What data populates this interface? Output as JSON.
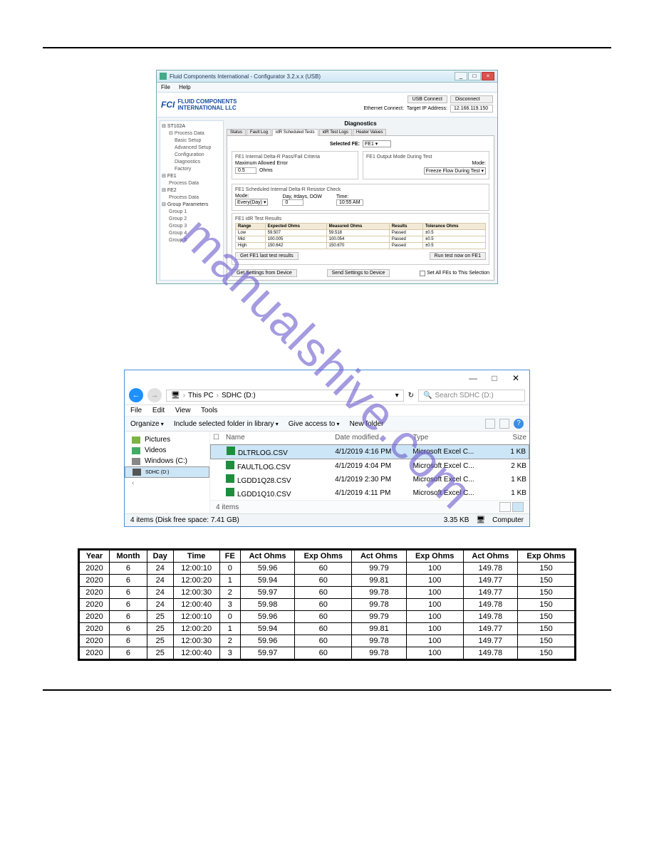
{
  "watermark": "manualshive.com",
  "app": {
    "title": "Fluid Components International - Configurator 3.2.x.x (USB)",
    "menu": {
      "file": "File",
      "help": "Help"
    },
    "logo_prefix": "FCI",
    "logo_line1": "FLUID COMPONENTS",
    "logo_line2": "INTERNATIONAL LLC",
    "conn": {
      "usb_btn": "USB Connect",
      "eth_label": "Ethernet Connect:",
      "ip_label": "Target IP Address:",
      "ip_value": "12.166.119.150",
      "disconnect": "Disconnect"
    },
    "tree": {
      "root": "ST102A",
      "n1": "Process Data",
      "n2": "Basic Setup",
      "n3": "Advanced Setup",
      "n4": "Configuration",
      "n5": "Diagnostics",
      "n6": "Factory",
      "fe1": "FE1",
      "fe1_pd": "Process Data",
      "fe2": "FE2",
      "fe2_pd": "Process Data",
      "grp": "Group Parameters",
      "g1": "Group 1",
      "g2": "Group 2",
      "g3": "Group 3",
      "g4": "Group 4",
      "g5": "Group 5"
    },
    "diag": {
      "title": "Diagnostics",
      "tabs": {
        "status": "Status",
        "fault": "Fault Log",
        "sched": "idR Scheduled Tests",
        "logs": "idR Test Logs",
        "heater": "Heater Values"
      },
      "selected_fe_label": "Selected FE:",
      "selected_fe_value": "FE1",
      "fs1_title": "FE1 Internal Delta-R Pass/Fail Criteria",
      "max_err_label": "Maximum Allowed Error",
      "max_err_value": "0.5",
      "ohms": "Ohms",
      "fs2_title": "FE1 Output Mode During Test",
      "mode_label": "Mode:",
      "mode_value": "Freeze Flow During Test",
      "fs3_title": "FE1 Scheduled Internal Delta-R Resistor Check",
      "mode2_value": "Every(Day)",
      "day_label": "Day, #days, DOW",
      "day_value": "0",
      "time_label": "Time:",
      "time_value": "10:55 AM",
      "fs4_title": "FE1 idR Test Results",
      "res_headers": [
        "Range",
        "Expected Ohms",
        "Measured Ohms",
        "Results",
        "Tolerance Ohms"
      ],
      "res_rows": [
        [
          "Low",
          "59.507",
          "59.518",
          "Passed",
          "±0.5"
        ],
        [
          "Mid",
          "100.005",
          "100.054",
          "Passed",
          "±0.5"
        ],
        [
          "High",
          "150.642",
          "150.670",
          "Passed",
          "±0.5"
        ]
      ],
      "get_results_btn": "Get FE1 last test results",
      "run_now_btn": "Run test now on FE1",
      "get_settings": "Get Settings from Device",
      "send_settings": "Send Settings to Device",
      "set_all_fe": "Set All FEs to This Selection"
    }
  },
  "explorer": {
    "path_pc": "This PC",
    "path_drive": "SDHC (D:)",
    "search_placeholder": "Search SDHC (D:)",
    "menu": {
      "file": "File",
      "edit": "Edit",
      "view": "View",
      "tools": "Tools"
    },
    "toolbar": {
      "organize": "Organize",
      "include": "Include selected folder in library",
      "give": "Give access to",
      "newf": "New folder"
    },
    "side": {
      "pictures": "Pictures",
      "videos": "Videos",
      "windows": "Windows (C:)",
      "sdhc": "SDHC (D:)"
    },
    "cols": {
      "name": "Name",
      "date": "Date modified",
      "type": "Type",
      "size": "Size"
    },
    "files": [
      {
        "name": "DLTRLOG.CSV",
        "date": "4/1/2019 4:16 PM",
        "type": "Microsoft Excel C...",
        "size": "1 KB",
        "sel": true
      },
      {
        "name": "FAULTLOG.CSV",
        "date": "4/1/2019 4:04 PM",
        "type": "Microsoft Excel C...",
        "size": "2 KB",
        "sel": false
      },
      {
        "name": "LGDD1Q28.CSV",
        "date": "4/1/2019 2:30 PM",
        "type": "Microsoft Excel C...",
        "size": "1 KB",
        "sel": false
      },
      {
        "name": "LGDD1Q10.CSV",
        "date": "4/1/2019 4:11 PM",
        "type": "Microsoft Excel C...",
        "size": "1 KB",
        "sel": false
      }
    ],
    "items_count": "4 items",
    "status": "4 items (Disk free space: 7.41 GB)",
    "status_size": "3.35 KB",
    "status_computer": "Computer"
  },
  "table": {
    "headers": [
      "Year",
      "Month",
      "Day",
      "Time",
      "FE",
      "Act Ohms",
      "Exp Ohms",
      "Act Ohms",
      "Exp Ohms",
      "Act Ohms",
      "Exp Ohms"
    ],
    "rows": [
      [
        "2020",
        "6",
        "24",
        "12:00:10",
        "0",
        "59.96",
        "60",
        "99.79",
        "100",
        "149.78",
        "150"
      ],
      [
        "2020",
        "6",
        "24",
        "12:00:20",
        "1",
        "59.94",
        "60",
        "99.81",
        "100",
        "149.77",
        "150"
      ],
      [
        "2020",
        "6",
        "24",
        "12:00:30",
        "2",
        "59.97",
        "60",
        "99.78",
        "100",
        "149.77",
        "150"
      ],
      [
        "2020",
        "6",
        "24",
        "12:00:40",
        "3",
        "59.98",
        "60",
        "99.78",
        "100",
        "149.78",
        "150"
      ],
      [
        "2020",
        "6",
        "25",
        "12:00:10",
        "0",
        "59.96",
        "60",
        "99.79",
        "100",
        "149.78",
        "150"
      ],
      [
        "2020",
        "6",
        "25",
        "12:00:20",
        "1",
        "59.94",
        "60",
        "99.81",
        "100",
        "149.77",
        "150"
      ],
      [
        "2020",
        "6",
        "25",
        "12:00:30",
        "2",
        "59.96",
        "60",
        "99.78",
        "100",
        "149.77",
        "150"
      ],
      [
        "2020",
        "6",
        "25",
        "12:00:40",
        "3",
        "59.97",
        "60",
        "99.78",
        "100",
        "149.78",
        "150"
      ]
    ]
  }
}
